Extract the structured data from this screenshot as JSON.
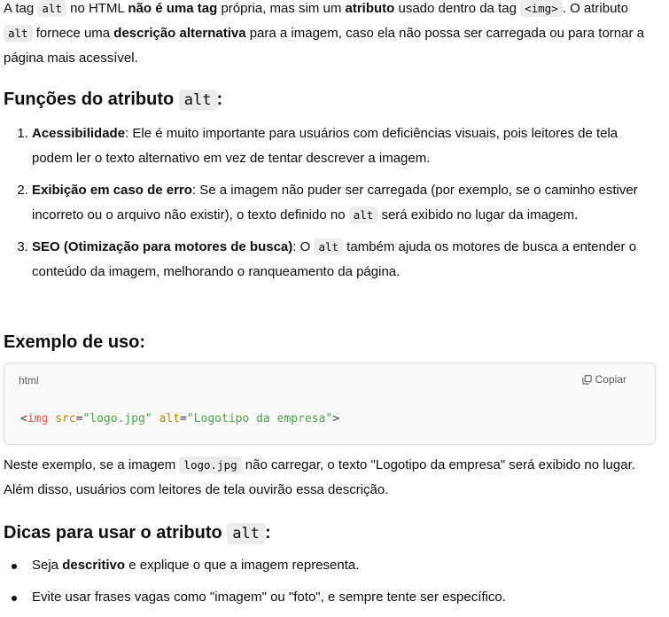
{
  "intro": {
    "t1": "A tag ",
    "c1": "alt",
    "t2": " no HTML ",
    "b1": "não é uma tag",
    "t3": " própria, mas sim um ",
    "b2": "atributo",
    "t4": " usado dentro da tag ",
    "c2": "<img>",
    "t5": ". O atributo ",
    "c3": "alt",
    "t6": " fornece uma ",
    "b3": "descrição alternativa",
    "t7": " para a imagem, caso ela não possa ser carregada ou para tornar a página mais acessível."
  },
  "section1": {
    "title": "Funções do atributo ",
    "code": "alt",
    "suffix": ":"
  },
  "functions": [
    {
      "bold": "Acessibilidade",
      "text": ": Ele é muito importante para usuários com deficiências visuais, pois leitores de tela podem ler o texto alternativo em vez de tentar descrever a imagem."
    },
    {
      "bold": "Exibição em caso de erro",
      "text": ": Se a imagem não puder ser carregada (por exemplo, se o caminho estiver incorreto ou o arquivo não existir), o texto definido no ",
      "code": "alt",
      "text2": " será exibido no lugar da imagem."
    },
    {
      "bold": "SEO (Otimização para motores de busca)",
      "text": ": O ",
      "code": "alt",
      "text2": " também ajuda os motores de busca a entender o conteúdo da imagem, melhorando o ranqueamento da página."
    }
  ],
  "section2": {
    "title": "Exemplo de uso:"
  },
  "codeblock": {
    "lang": "html",
    "copy_label": "Copiar",
    "copy_icon": "copy-icon",
    "tokens": {
      "open": "<",
      "tag": "img",
      "sp1": " ",
      "attr1": "src",
      "eq1": "=",
      "val1": "\"logo.jpg\"",
      "sp2": " ",
      "attr2": "alt",
      "eq2": "=",
      "val2": "\"Logotipo da empresa\"",
      "close": ">"
    },
    "colors": {
      "tag": "#e45649",
      "attr": "#c18401",
      "string": "#50a14f"
    }
  },
  "after": {
    "t1": "Neste exemplo, se a imagem ",
    "c1": "logo.jpg",
    "t2": " não carregar, o texto \"Logotipo da empresa\" será exibido no lugar. Além disso, usuários com leitores de tela ouvirão essa descrição."
  },
  "section3": {
    "title": "Dicas para usar o atributo ",
    "code": "alt",
    "suffix": ":"
  },
  "tips": [
    {
      "t1": "Seja ",
      "bold": "descritivo",
      "t2": " e explique o que a imagem representa."
    },
    {
      "t1": "Evite usar frases vagas como \"imagem\" ou \"foto\", e sempre tente ser específico."
    }
  ]
}
